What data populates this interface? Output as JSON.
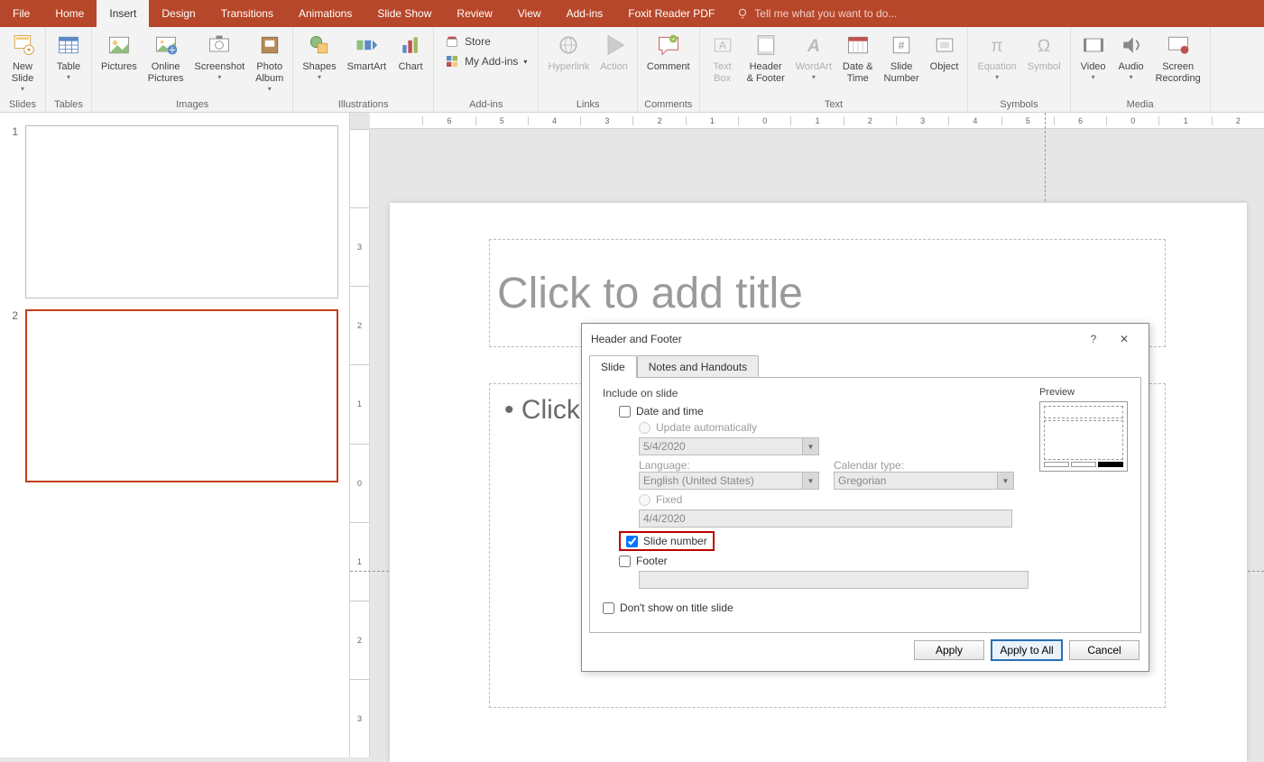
{
  "tabs": [
    "File",
    "Home",
    "Insert",
    "Design",
    "Transitions",
    "Animations",
    "Slide Show",
    "Review",
    "View",
    "Add-ins",
    "Foxit Reader PDF"
  ],
  "active_tab": "Insert",
  "tell_me": "Tell me what you want to do...",
  "groups": {
    "slides": {
      "label": "Slides",
      "new_slide": "New\nSlide"
    },
    "tables": {
      "label": "Tables",
      "table": "Table"
    },
    "images": {
      "label": "Images",
      "pictures": "Pictures",
      "online_pictures": "Online\nPictures",
      "screenshot": "Screenshot",
      "photo_album": "Photo\nAlbum"
    },
    "illustrations": {
      "label": "Illustrations",
      "shapes": "Shapes",
      "smartart": "SmartArt",
      "chart": "Chart"
    },
    "addins": {
      "label": "Add-ins",
      "store": "Store",
      "my": "My Add-ins"
    },
    "links": {
      "label": "Links",
      "hyperlink": "Hyperlink",
      "action": "Action"
    },
    "comments": {
      "label": "Comments",
      "comment": "Comment"
    },
    "text": {
      "label": "Text",
      "text_box": "Text\nBox",
      "header_footer": "Header\n& Footer",
      "wordart": "WordArt",
      "date_time": "Date &\nTime",
      "slide_number": "Slide\nNumber",
      "object": "Object"
    },
    "symbols": {
      "label": "Symbols",
      "equation": "Equation",
      "symbol": "Symbol"
    },
    "media": {
      "label": "Media",
      "video": "Video",
      "audio": "Audio",
      "screen_recording": "Screen\nRecording"
    }
  },
  "ruler_h": [
    "",
    "6",
    "5",
    "4",
    "3",
    "2",
    "1",
    "0",
    "1",
    "2",
    "3",
    "4",
    "5",
    "6",
    "0",
    "1",
    "2"
  ],
  "ruler_v": [
    "",
    "3",
    "2",
    "1",
    "0",
    "1",
    "2",
    "3"
  ],
  "thumbs": [
    "1",
    "2"
  ],
  "selected_thumb": 2,
  "placeholders": {
    "title": "Click to add title",
    "body": "Click"
  },
  "dialog": {
    "title": "Header and Footer",
    "tabs": [
      "Slide",
      "Notes and Handouts"
    ],
    "active_tab": "Slide",
    "include_label": "Include on slide",
    "date_time": "Date and time",
    "update_auto": "Update automatically",
    "auto_date": "5/4/2020",
    "language_label": "Language:",
    "language_value": "English (United States)",
    "calendar_label": "Calendar type:",
    "calendar_value": "Gregorian",
    "fixed": "Fixed",
    "fixed_date": "4/4/2020",
    "slide_number": "Slide number",
    "footer": "Footer",
    "dont_show": "Don't show on title slide",
    "preview": "Preview",
    "apply": "Apply",
    "apply_all": "Apply to All",
    "cancel": "Cancel"
  }
}
